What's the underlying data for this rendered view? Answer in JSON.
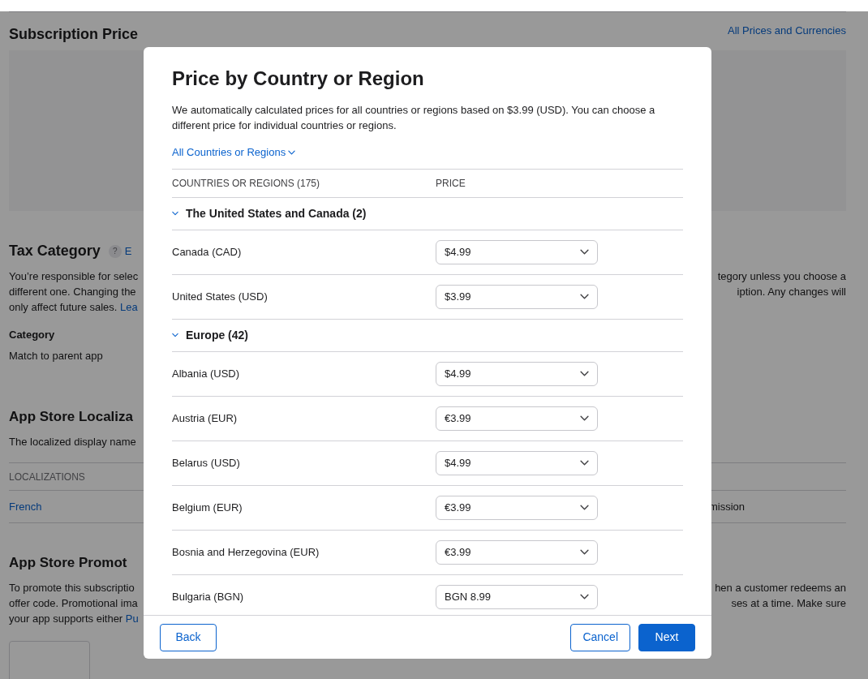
{
  "background": {
    "subscription_prices": {
      "heading": "Subscription Price",
      "link": "All Prices and Currencies"
    },
    "tax_category": {
      "heading": "Tax Category",
      "help": "?",
      "link": "E",
      "lines": [
        {
          "left": "You’re responsible for selec",
          "right": "tegory unless you choose a"
        },
        {
          "left": "different one. Changing the",
          "right": "iption. Any changes will"
        },
        {
          "left": "only affect future sales. ",
          "link": "Lea"
        }
      ],
      "field_label": "Category",
      "field_value": "Match to parent app"
    },
    "localization": {
      "heading": "App Store Localiza",
      "description": "The localized display name",
      "column": "LOCALIZATIONS",
      "rows": [
        {
          "left": "French",
          "right": "mission"
        }
      ]
    },
    "promotion": {
      "heading": "App Store Promot",
      "lines": [
        {
          "left": "To promote this subscriptio",
          "right": "hen a customer redeems an"
        },
        {
          "left": "offer code. Promotional ima",
          "right": "ses at a time. Make sure"
        },
        {
          "left": "your app supports either ",
          "link": "Pu"
        }
      ]
    }
  },
  "dialog": {
    "title": "Price by Country or Region",
    "description": "We automatically calculated prices for all countries or regions based on $3.99 (USD). You can choose a different price for individual countries or regions.",
    "filter": "All Countries or Regions",
    "columns": [
      "COUNTRIES OR REGIONS (175)",
      "PRICE"
    ],
    "groups": [
      {
        "name": "The United States and Canada (2)",
        "expanded": true,
        "rows": [
          {
            "country": "Canada (CAD)",
            "price": "$4.99"
          },
          {
            "country": "United States (USD)",
            "price": "$3.99"
          }
        ]
      },
      {
        "name": "Europe (42)",
        "expanded": true,
        "rows": [
          {
            "country": "Albania (USD)",
            "price": "$4.99"
          },
          {
            "country": "Austria (EUR)",
            "price": "€3.99"
          },
          {
            "country": "Belarus (USD)",
            "price": "$4.99"
          },
          {
            "country": "Belgium (EUR)",
            "price": "€3.99"
          },
          {
            "country": "Bosnia and Herzegovina (EUR)",
            "price": "€3.99"
          },
          {
            "country": "Bulgaria (BGN)",
            "price": "BGN 8.99"
          }
        ]
      }
    ],
    "buttons": [
      {
        "label": "Back",
        "kind": "secondary"
      },
      {
        "label": "Cancel",
        "kind": "secondary"
      },
      {
        "label": "Next",
        "kind": "primary"
      }
    ]
  }
}
